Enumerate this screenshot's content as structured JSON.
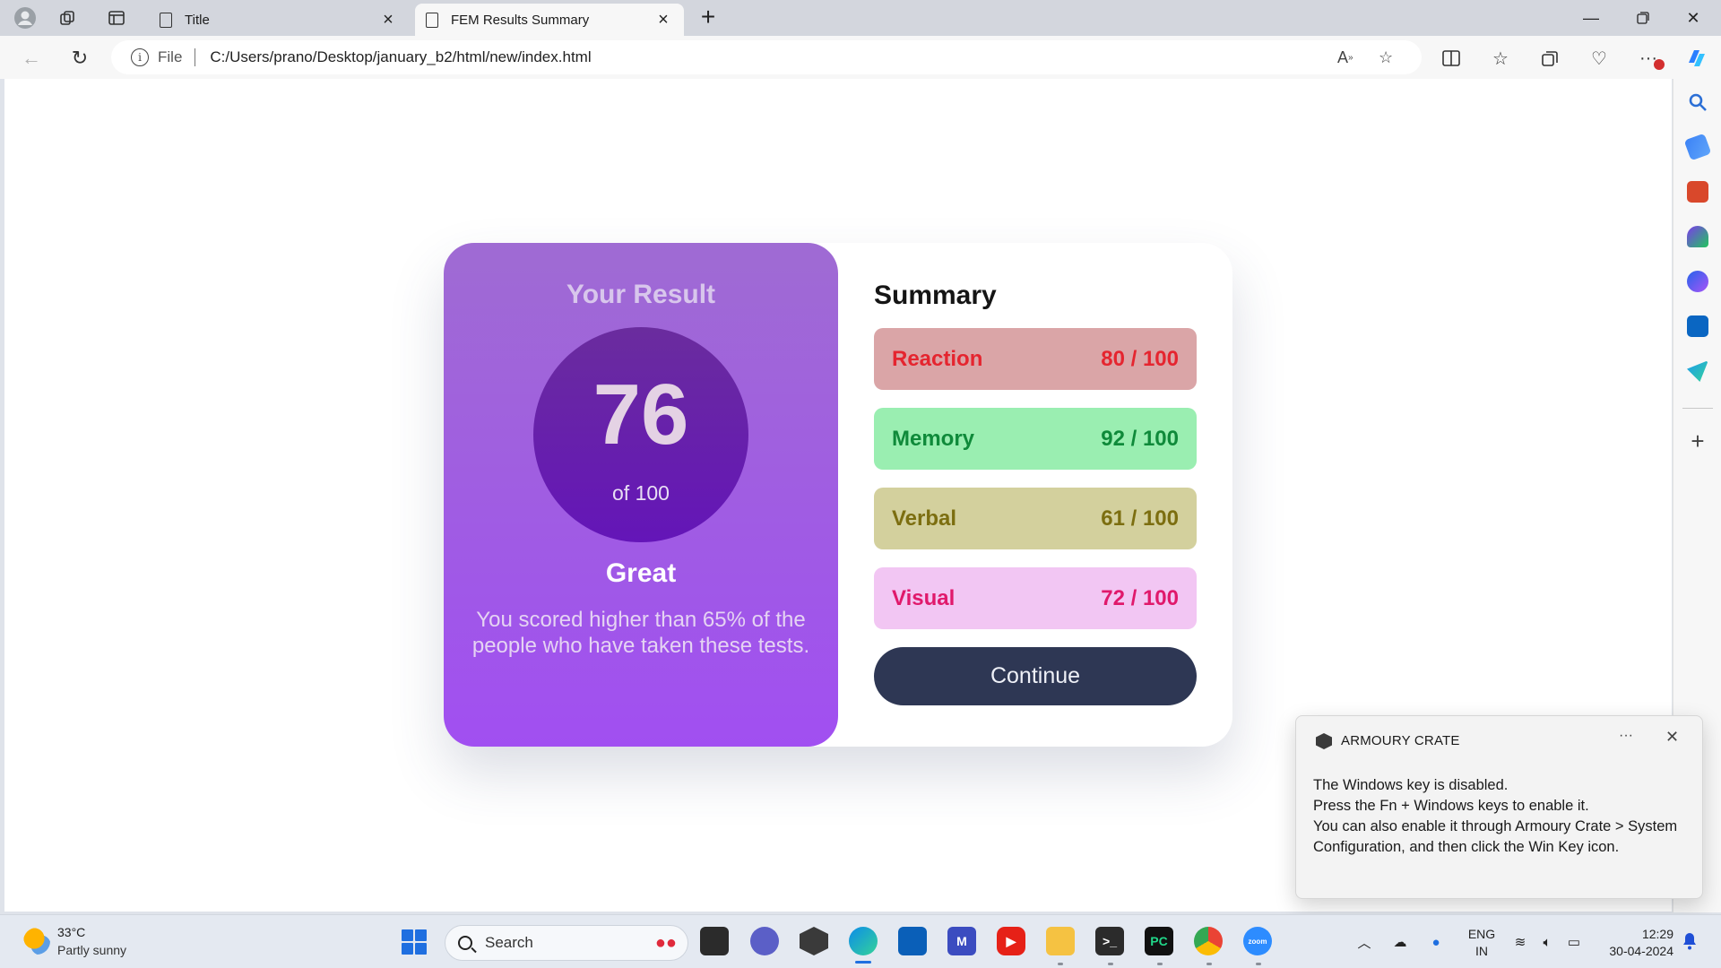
{
  "browser": {
    "tabs": [
      {
        "title": "Title",
        "active": false
      },
      {
        "title": "FEM Results Summary",
        "active": true
      }
    ],
    "address_scheme": "File",
    "address_url": "C:/Users/prano/Desktop/january_b2/html/new/index.html"
  },
  "page": {
    "result_heading": "Your Result",
    "score": "76",
    "score_of": "of 100",
    "grade": "Great",
    "description": "You scored higher than 65% of the people who have taken these tests.",
    "summary_title": "Summary",
    "categories": [
      {
        "label": "Reaction",
        "score": "80 / 100",
        "bg": "#daa5a7",
        "fg": "#e5252f"
      },
      {
        "label": "Memory",
        "score": "92 / 100",
        "bg": "#9aeeb1",
        "fg": "#0f8a3a"
      },
      {
        "label": "Verbal",
        "score": "61 / 100",
        "bg": "#d3d09d",
        "fg": "#7c6e10"
      },
      {
        "label": "Visual",
        "score": "72 / 100",
        "bg": "#f2c6f3",
        "fg": "#e0196b"
      }
    ],
    "continue_label": "Continue"
  },
  "notification": {
    "app_name": "ARMOURY CRATE",
    "more_label": "···",
    "lines": [
      "The Windows key is disabled.",
      "Press the Fn + Windows keys to enable it.",
      "You can also enable it through Armoury Crate > System Configuration, and then click the Win Key icon."
    ]
  },
  "taskbar": {
    "weather_temp": "33°C",
    "weather_desc": "Partly sunny",
    "search_placeholder": "Search",
    "lang_primary": "ENG",
    "lang_secondary": "IN",
    "time": "12:29",
    "date": "30-04-2024",
    "apps": [
      "task-view-icon",
      "teams-icon",
      "armoury-crate-icon",
      "edge-icon",
      "microsoft-store-icon",
      "visual-studio-icon",
      "youtube-icon",
      "file-explorer-icon",
      "terminal-icon",
      "pycharm-icon",
      "chrome-icon",
      "zoom-icon"
    ]
  },
  "colors": {
    "result_gradient_top": "#9f6bd3",
    "result_gradient_bottom": "#a14ff1",
    "circle": "#6415b8",
    "continue_button": "#2e3754"
  }
}
